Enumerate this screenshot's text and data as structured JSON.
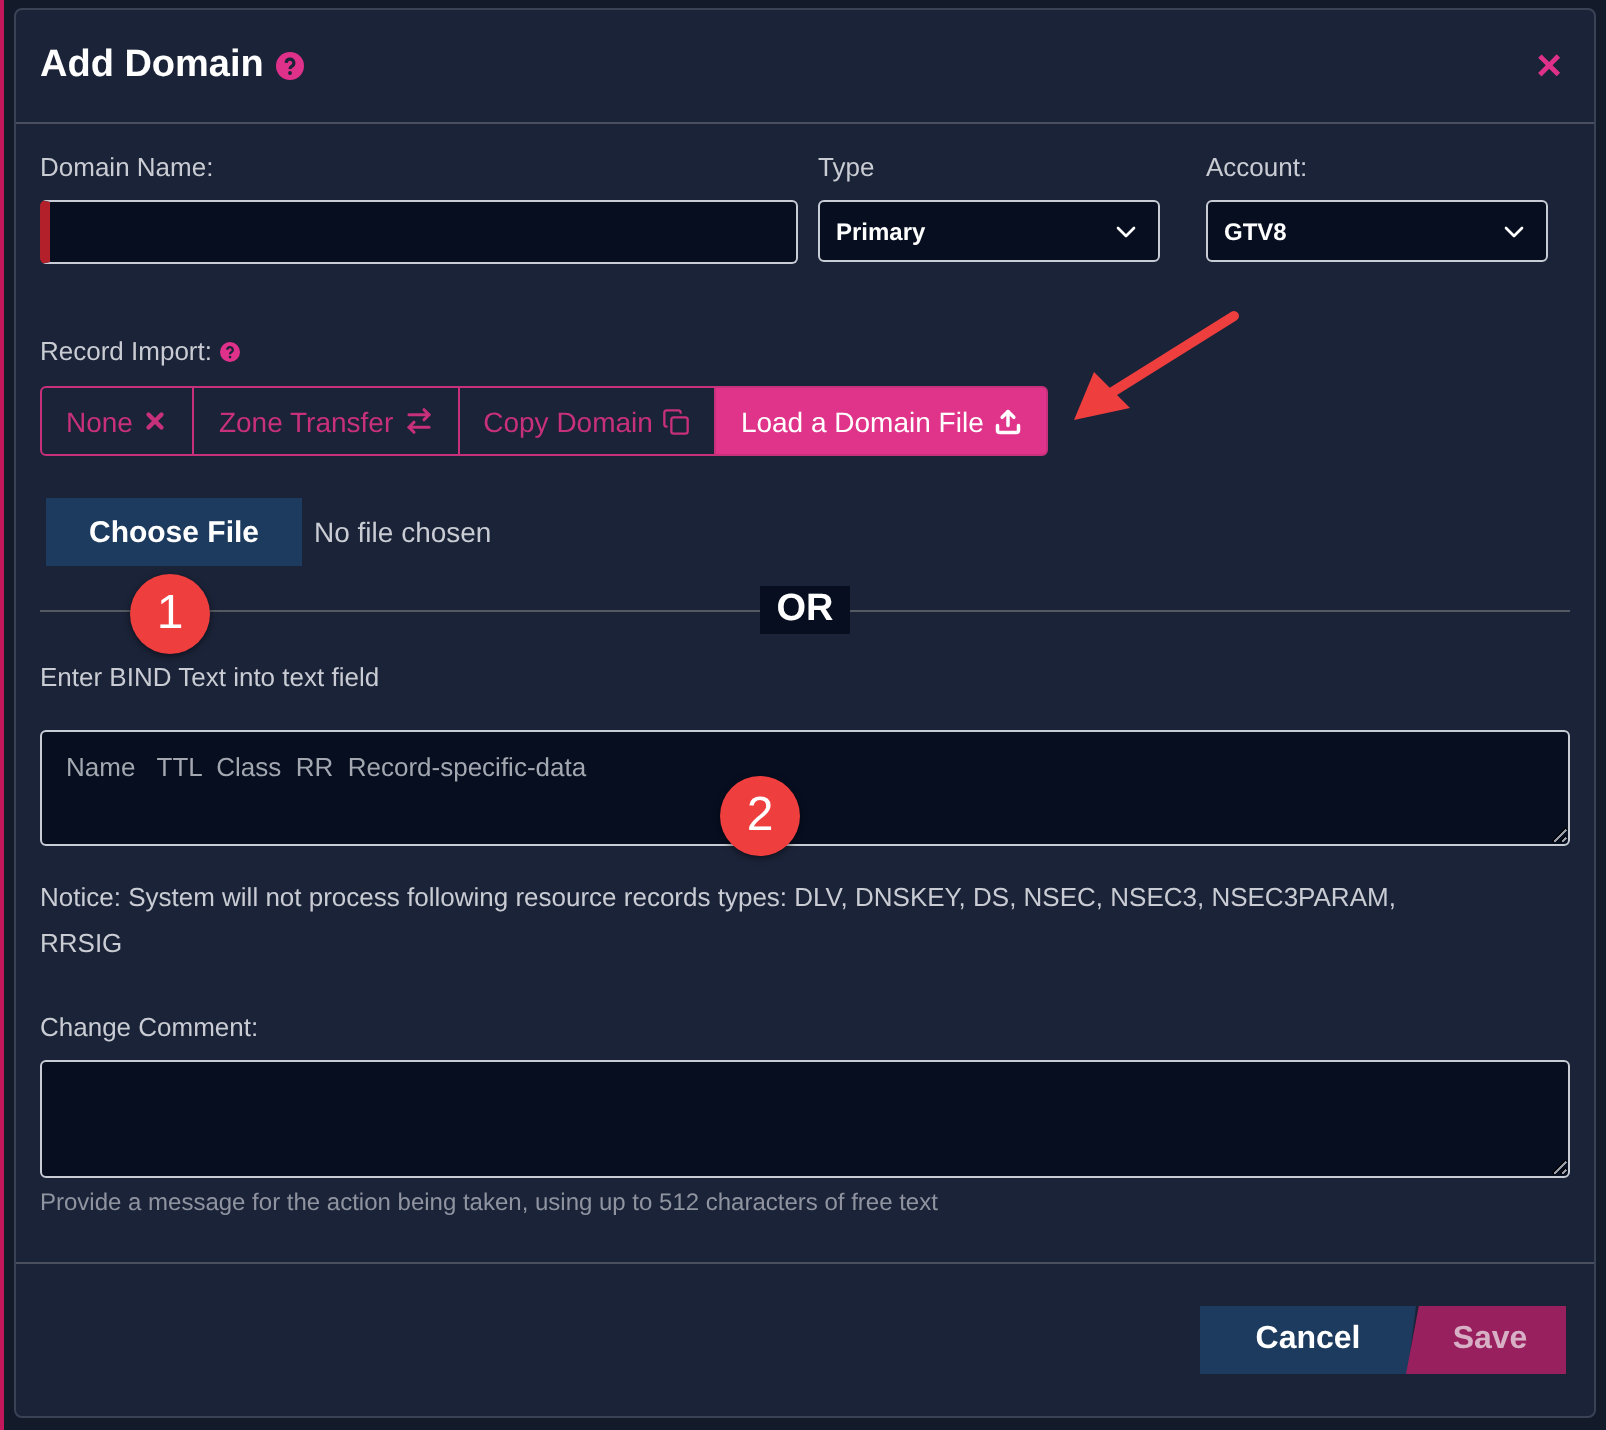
{
  "dialog": {
    "title": "Add Domain",
    "close": "×"
  },
  "fields": [
    {
      "label": "Domain Name:",
      "kind": "text",
      "required": true
    },
    {
      "label": "Type",
      "kind": "select",
      "value": "Primary"
    },
    {
      "label": "Account:",
      "kind": "select",
      "value": "GTV8"
    }
  ],
  "record_import": {
    "label": "Record Import:",
    "options": [
      {
        "label": "None",
        "kind": "none",
        "selected": false
      },
      {
        "label": "Zone Transfer",
        "kind": "transfer",
        "selected": false
      },
      {
        "label": "Copy Domain",
        "kind": "copy",
        "selected": false
      },
      {
        "label": "Load a Domain File",
        "kind": "upload",
        "selected": true
      }
    ]
  },
  "file": {
    "button": "Choose File",
    "status": "No file chosen"
  },
  "separator": "OR",
  "bind": {
    "label": "Enter BIND Text into text field",
    "placeholder": "Name   TTL  Class  RR  Record-specific-data"
  },
  "notice": "Notice: System will not process following resource records types: DLV, DNSKEY, DS, NSEC, NSEC3, NSEC3PARAM, RRSIG",
  "comment": {
    "label": "Change Comment:",
    "hint": "Provide a message for the action being taken, using up to 512 characters of free text"
  },
  "buttons": [
    {
      "label": "Cancel",
      "kind": "cancel"
    },
    {
      "label": "Save",
      "kind": "save"
    }
  ],
  "annotations": [
    {
      "label": "1",
      "kind": "marker"
    },
    {
      "label": "2",
      "kind": "marker"
    },
    {
      "kind": "arrow"
    }
  ]
}
